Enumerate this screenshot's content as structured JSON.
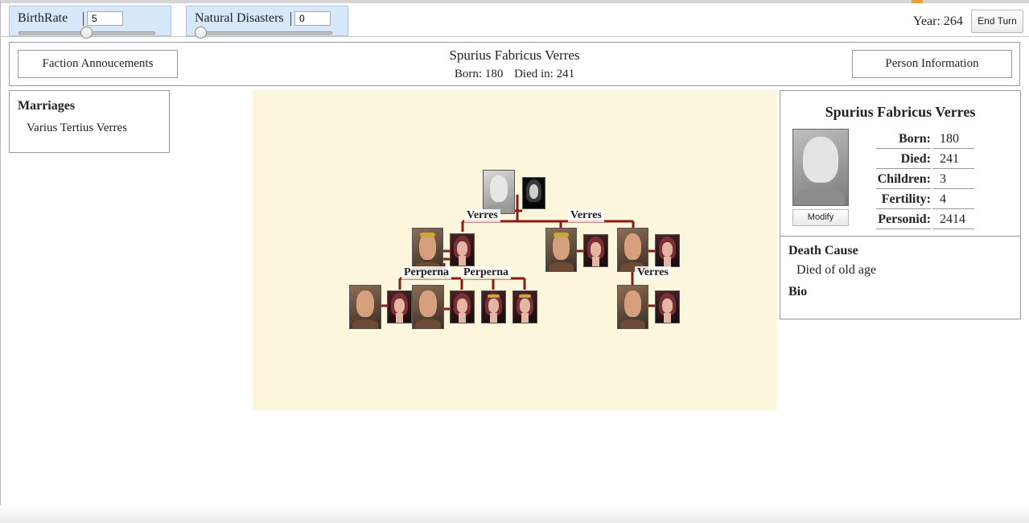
{
  "controls": {
    "birthrate": {
      "label": "BirthRate",
      "value": "5",
      "slider_fraction": 0.5
    },
    "disasters": {
      "label": "Natural Disasters",
      "value": "0",
      "slider_fraction": 0.0
    },
    "year_text": "Year: 264",
    "end_turn_label": "End Turn"
  },
  "header": {
    "left_button": "Faction Annoucements",
    "right_button": "Person Information",
    "name": "Spurius Fabricus Verres",
    "born": "Born: 180",
    "died": "Died in: 241"
  },
  "marriages": {
    "title": "Marriages",
    "items": [
      "Varius Tertius Verres"
    ]
  },
  "tree": {
    "family_labels": [
      "Verres",
      "Verres",
      "Perperna",
      "Perperna",
      "Verres"
    ]
  },
  "info": {
    "name": "Spurius Fabricus Verres",
    "modify_label": "Modify",
    "stats": [
      {
        "label": "Born:",
        "value": "180"
      },
      {
        "label": "Died:",
        "value": "241"
      },
      {
        "label": "Children:",
        "value": "3"
      },
      {
        "label": "Fertility:",
        "value": "4"
      },
      {
        "label": "Personid:",
        "value": "2414"
      }
    ],
    "death_cause_title": "Death Cause",
    "death_cause": "Died of old age",
    "bio_title": "Bio"
  },
  "colors": {
    "slider_bg": "#d7e8fb",
    "tree_bg": "#fcf6dc",
    "tree_line": "#8b1a12"
  }
}
